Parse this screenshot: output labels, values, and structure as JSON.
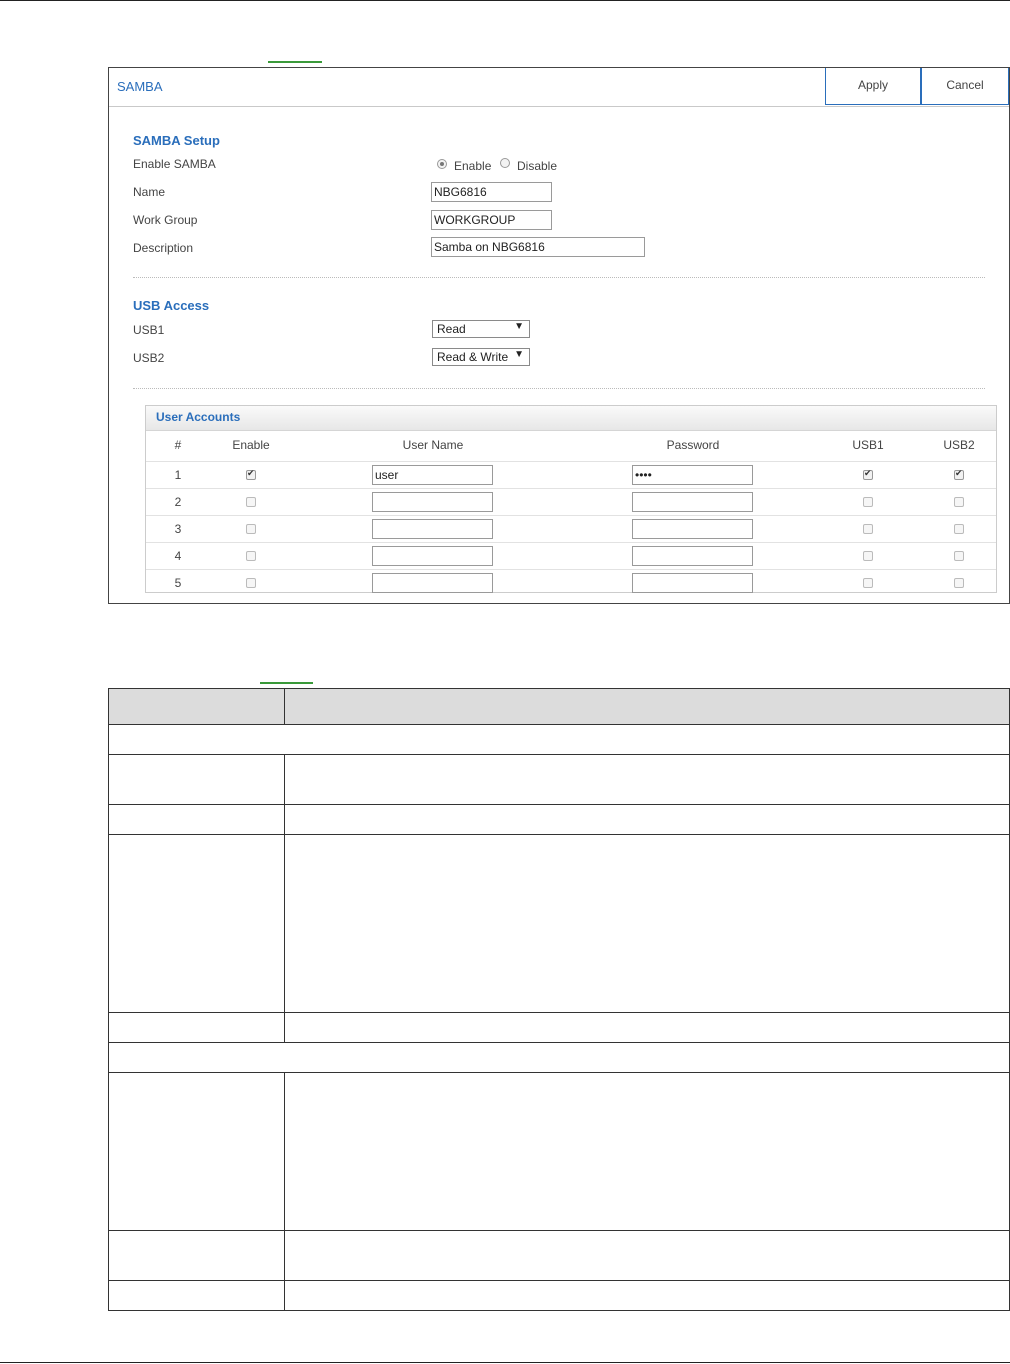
{
  "panel": {
    "title": "SAMBA",
    "apply_label": "Apply",
    "cancel_label": "Cancel"
  },
  "samba_setup": {
    "section_title": "SAMBA Setup",
    "enable_label": "Enable SAMBA",
    "enable_option": "Enable",
    "disable_option": "Disable",
    "enabled": true,
    "name_label": "Name",
    "name_value": "NBG6816",
    "workgroup_label": "Work Group",
    "workgroup_value": "WORKGROUP",
    "description_label": "Description",
    "description_value": "Samba on NBG6816"
  },
  "usb_access": {
    "section_title": "USB Access",
    "usb1_label": "USB1",
    "usb1_value": "Read",
    "usb2_label": "USB2",
    "usb2_value": "Read & Write"
  },
  "user_accounts": {
    "title": "User Accounts",
    "columns": [
      "#",
      "Enable",
      "User Name",
      "Password",
      "USB1",
      "USB2"
    ],
    "rows": [
      {
        "num": "1",
        "enable": true,
        "user": "user",
        "password": "••••",
        "usb1": true,
        "usb2": true
      },
      {
        "num": "2",
        "enable": false,
        "user": "",
        "password": "",
        "usb1": false,
        "usb2": false
      },
      {
        "num": "3",
        "enable": false,
        "user": "",
        "password": "",
        "usb1": false,
        "usb2": false
      },
      {
        "num": "4",
        "enable": false,
        "user": "",
        "password": "",
        "usb1": false,
        "usb2": false
      },
      {
        "num": "5",
        "enable": false,
        "user": "",
        "password": "",
        "usb1": false,
        "usb2": false
      }
    ]
  },
  "colors": {
    "accent": "#2a6ebb",
    "link_stub": "#3a9a3a"
  }
}
